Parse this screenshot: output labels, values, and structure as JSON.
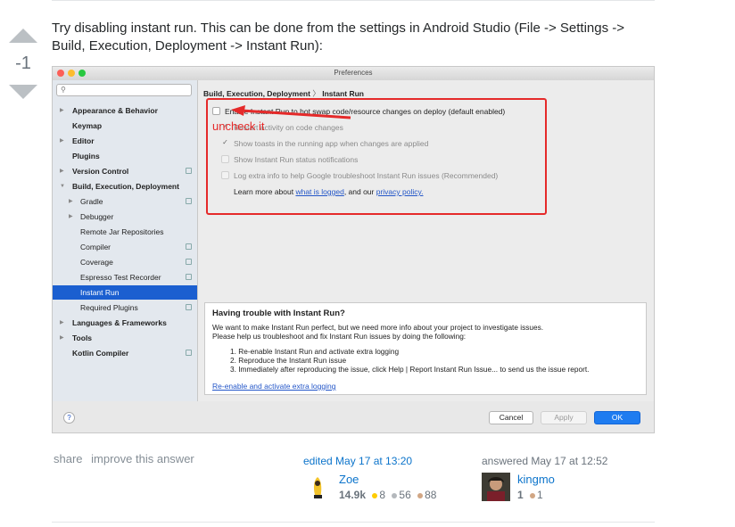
{
  "vote": {
    "score": "-1"
  },
  "answer": {
    "text": "Try disabling instant run. This can be done from the settings in Android Studio (File -> Settings -> Build, Execution, Deployment -> Instant Run):"
  },
  "dialog": {
    "title": "Preferences",
    "search_placeholder": "",
    "tree": [
      {
        "label": "Appearance & Behavior",
        "bold": true,
        "expandable": true
      },
      {
        "label": "Keymap",
        "bold": true
      },
      {
        "label": "Editor",
        "bold": true,
        "expandable": true
      },
      {
        "label": "Plugins",
        "bold": true
      },
      {
        "label": "Version Control",
        "bold": true,
        "expandable": true
      },
      {
        "label": "Build, Execution, Deployment",
        "bold": true,
        "expanded": true
      },
      {
        "label": "Gradle",
        "expandable": true
      },
      {
        "label": "Debugger",
        "expandable": true
      },
      {
        "label": "Remote Jar Repositories"
      },
      {
        "label": "Compiler"
      },
      {
        "label": "Coverage"
      },
      {
        "label": "Espresso Test Recorder"
      },
      {
        "label": "Instant Run",
        "selected": true
      },
      {
        "label": "Required Plugins"
      },
      {
        "label": "Languages & Frameworks",
        "bold": true,
        "expandable": true
      },
      {
        "label": "Tools",
        "bold": true,
        "expandable": true
      },
      {
        "label": "Kotlin Compiler",
        "bold": true
      }
    ],
    "breadcrumb": {
      "parent": "Build, Execution, Deployment",
      "sep": "〉",
      "current": "Instant Run"
    },
    "options": {
      "enable": "Enable Instant Run to hot swap code/resource changes on deploy (default enabled)",
      "restart": "Restart activity on code changes",
      "toasts": "Show toasts in the running app when changes are applied",
      "status": "Show Instant Run status notifications",
      "log": "Log extra info to help Google troubleshoot Instant Run issues (Recommended)",
      "learn_prefix": "Learn more about ",
      "learn_link": "what is logged",
      "learn_mid": ", and our ",
      "privacy_link": "privacy policy."
    },
    "annotation": "uncheck it",
    "trouble": {
      "title": "Having trouble with Instant Run?",
      "line1": "We want to make Instant Run perfect, but we need more info about your project to investigate issues.",
      "line2": "Please help us troubleshoot and fix Instant Run issues by doing the following:",
      "step1": "1. Re-enable Instant Run and activate extra logging",
      "step2": "2. Reproduce the Instant Run issue",
      "step3": "3. Immediately after reproducing the issue, click Help | Report Instant Run Issue... to send us the issue report.",
      "link": "Re-enable and activate extra logging"
    },
    "buttons": {
      "help": "?",
      "cancel": "Cancel",
      "apply": "Apply",
      "ok": "OK"
    }
  },
  "post_menu": {
    "share": "share",
    "improve": "improve this answer"
  },
  "edited": {
    "action": "edited May 17 at 13:20",
    "user": "Zoe",
    "rep": "14.9k",
    "gold": "8",
    "silver": "56",
    "bronze": "88"
  },
  "answered": {
    "action": "answered May 17 at 12:52",
    "user": "kingmo",
    "rep": "1",
    "bronze": "1"
  }
}
